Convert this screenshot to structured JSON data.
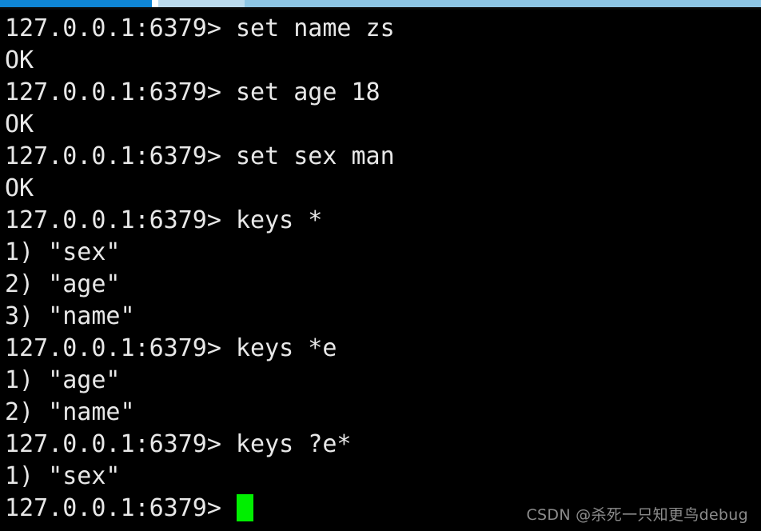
{
  "top_bar": {
    "progress_pct": 20,
    "progress_color": "#0f86d6",
    "track_color": "#9dcde8",
    "gap_color": "#ffffff"
  },
  "terminal": {
    "background_color": "#000000",
    "foreground_color": "#e8e8e8",
    "cursor_color": "#00ef00",
    "prompt": "127.0.0.1:6379>",
    "lines": [
      {
        "kind": "prompt",
        "text": "127.0.0.1:6379> set name zs"
      },
      {
        "kind": "output",
        "text": "OK"
      },
      {
        "kind": "prompt",
        "text": "127.0.0.1:6379> set age 18"
      },
      {
        "kind": "output",
        "text": "OK"
      },
      {
        "kind": "prompt",
        "text": "127.0.0.1:6379> set sex man"
      },
      {
        "kind": "output",
        "text": "OK"
      },
      {
        "kind": "prompt",
        "text": "127.0.0.1:6379> keys *"
      },
      {
        "kind": "output",
        "text": "1) \"sex\""
      },
      {
        "kind": "output",
        "text": "2) \"age\""
      },
      {
        "kind": "output",
        "text": "3) \"name\""
      },
      {
        "kind": "prompt",
        "text": "127.0.0.1:6379> keys *e"
      },
      {
        "kind": "output",
        "text": "1) \"age\""
      },
      {
        "kind": "output",
        "text": "2) \"name\""
      },
      {
        "kind": "prompt",
        "text": "127.0.0.1:6379> keys ?e*"
      },
      {
        "kind": "output",
        "text": "1) \"sex\""
      },
      {
        "kind": "cursor",
        "text": "127.0.0.1:6379> "
      }
    ]
  },
  "watermark": {
    "text": "CSDN @杀死一只知更鸟debug",
    "color": "#8c8c8c"
  }
}
